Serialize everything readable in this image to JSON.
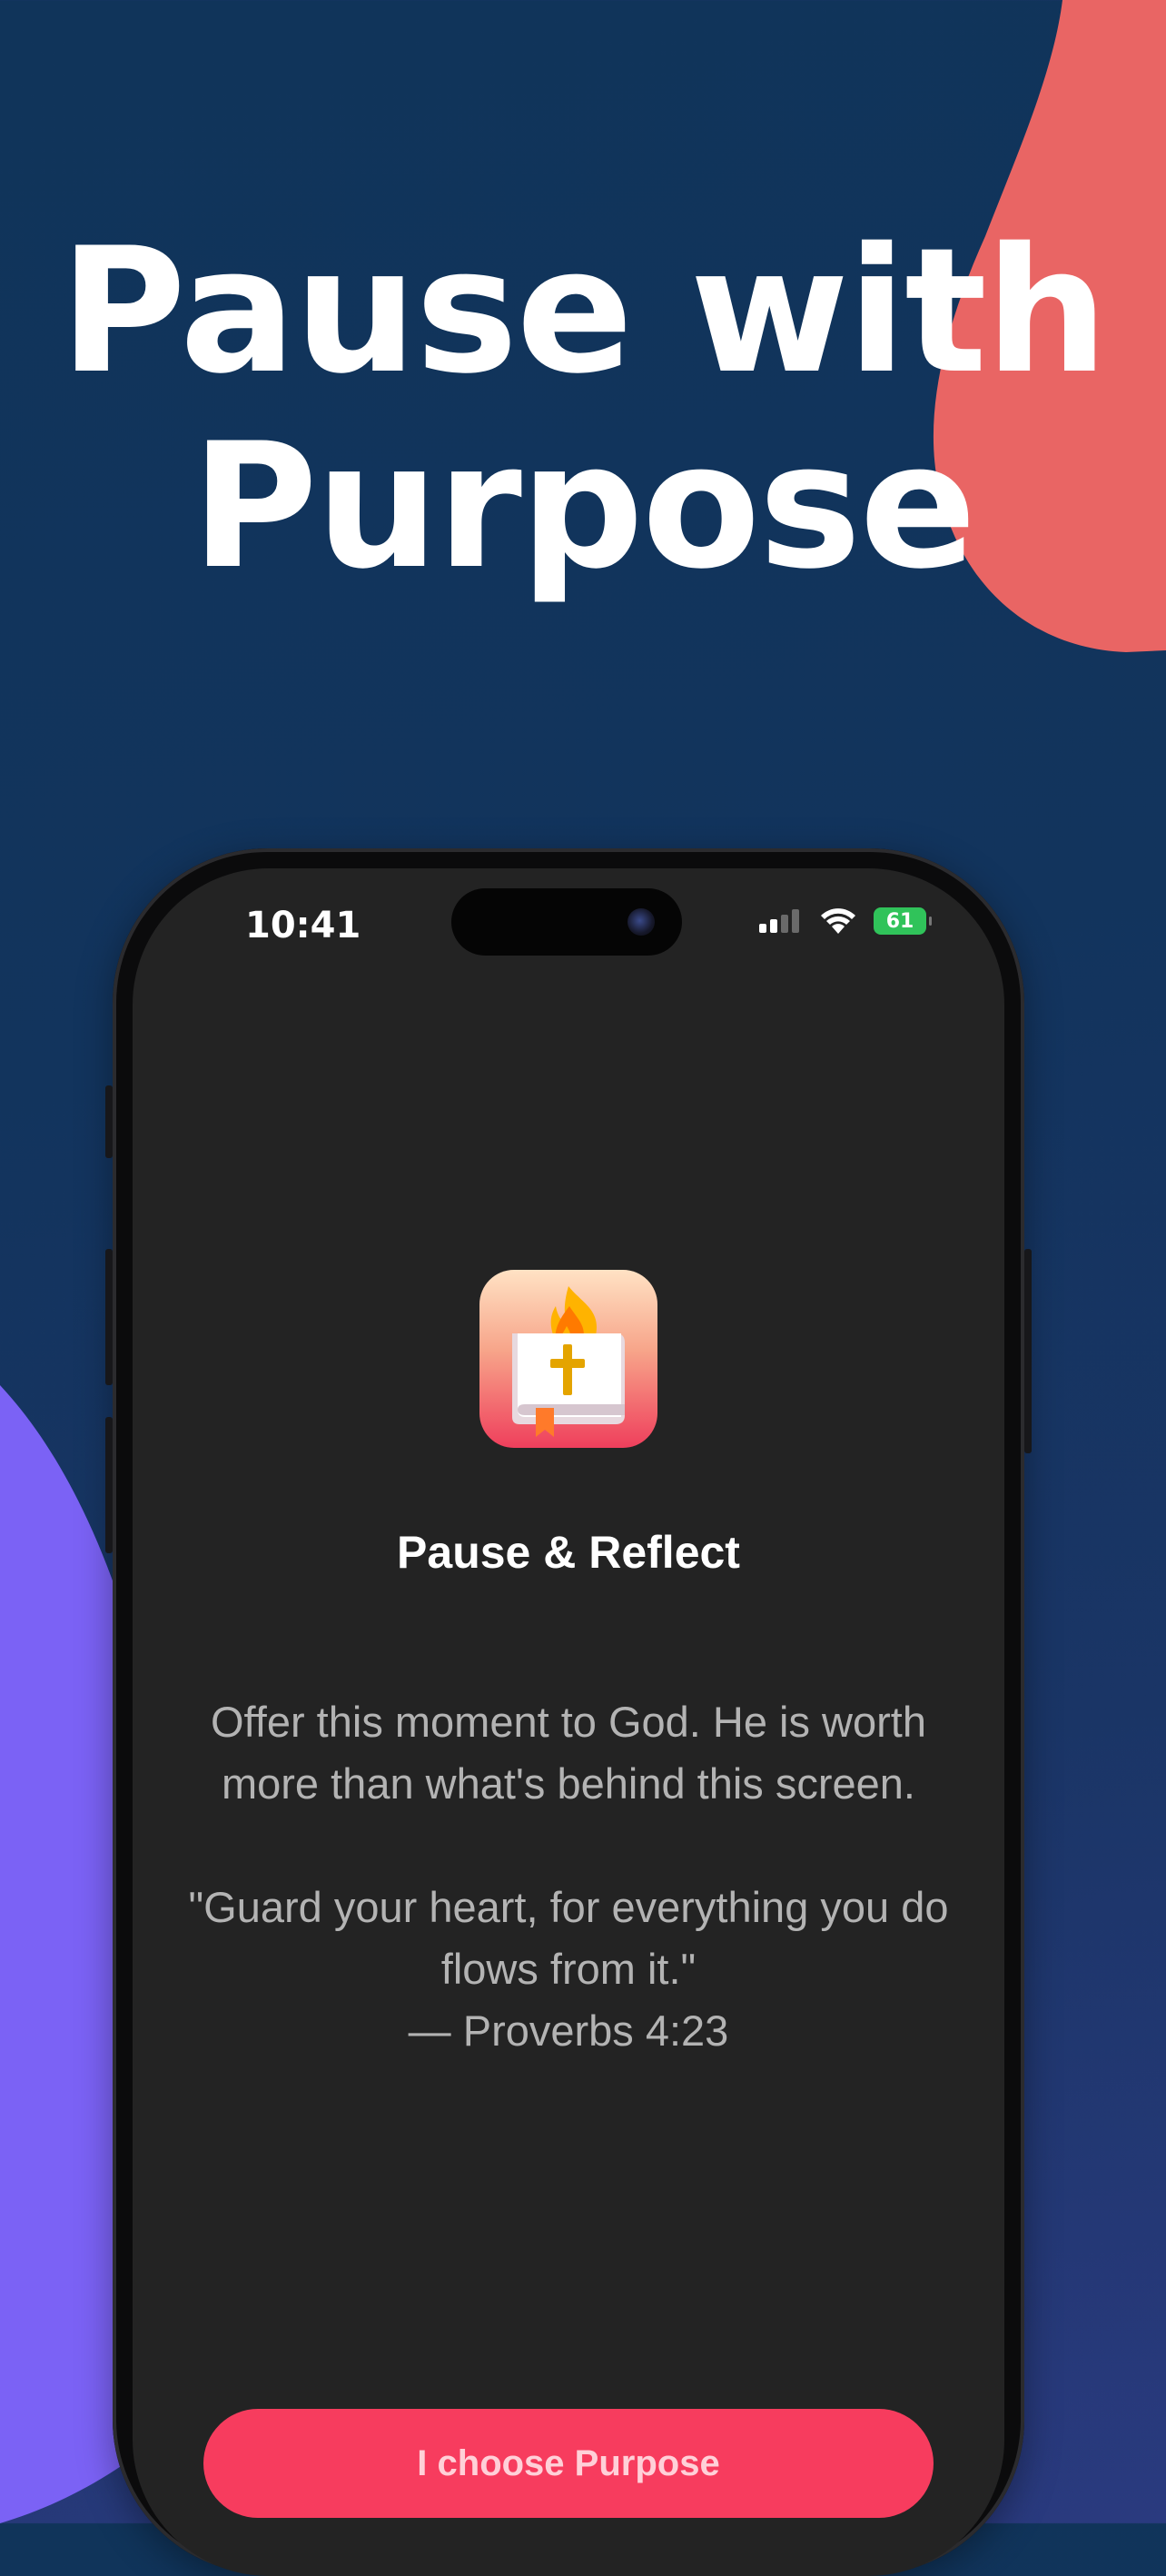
{
  "headline": {
    "line1": "Pause with",
    "line2": "Purpose"
  },
  "colors": {
    "background": "#10345a",
    "coral_blob": "#e96564",
    "purple_blob": "#7b62f5",
    "screen": "#232323",
    "accent_button": "#f73c5e",
    "battery": "#30c35a"
  },
  "status_bar": {
    "time": "10:41",
    "battery_level": "61",
    "icons": [
      "signal-icon",
      "wifi-icon",
      "battery-charging-icon"
    ]
  },
  "modal": {
    "app_icon": "bible-flame-icon",
    "title": "Pause & Reflect",
    "message": "Offer this moment to God. He is worth more than what's behind this screen.",
    "quote": "\"Guard your heart, for everything you do flows from it.\"",
    "reference": "— Proverbs 4:23",
    "cta_label": "I choose Purpose"
  }
}
